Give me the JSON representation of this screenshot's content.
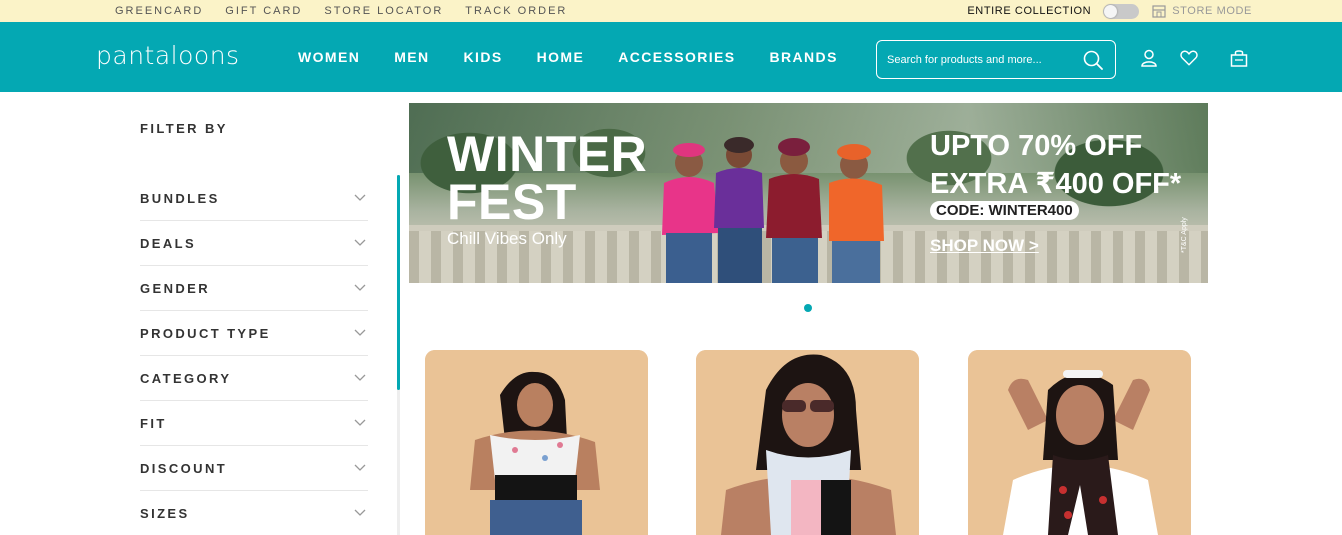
{
  "topbar": {
    "links": [
      "GREENCARD",
      "GIFT CARD",
      "STORE LOCATOR",
      "TRACK ORDER"
    ],
    "entire_collection": "ENTIRE COLLECTION",
    "store_mode": "STORE MODE"
  },
  "header": {
    "logo": "pantaloons",
    "nav": [
      "WOMEN",
      "MEN",
      "KIDS",
      "HOME",
      "ACCESSORIES",
      "BRANDS"
    ],
    "search_placeholder": "Search for products and more...",
    "brand_color": "#04a8b3"
  },
  "sidebar": {
    "title": "FILTER BY",
    "filters": [
      "BUNDLES",
      "DEALS",
      "GENDER",
      "PRODUCT TYPE",
      "CATEGORY",
      "FIT",
      "DISCOUNT",
      "SIZES"
    ]
  },
  "banner": {
    "headline_line1": "WINTER",
    "headline_line2": "FEST",
    "tagline": "Chill Vibes Only",
    "offer_line1": "UPTO 70% OFF",
    "offer_line2": "EXTRA ₹400 OFF*",
    "code": "CODE: WINTER400",
    "cta": "SHOP NOW >",
    "terms": "*T&C Apply"
  },
  "carousel": {
    "active_index": 0,
    "count": 1
  },
  "products": [
    {
      "image": "woman-wearing-printed-scarf-black-top"
    },
    {
      "image": "woman-wearing-sunglasses-printed-scarf"
    },
    {
      "image": "woman-wearing-red-black-scarf-white-tee"
    }
  ]
}
